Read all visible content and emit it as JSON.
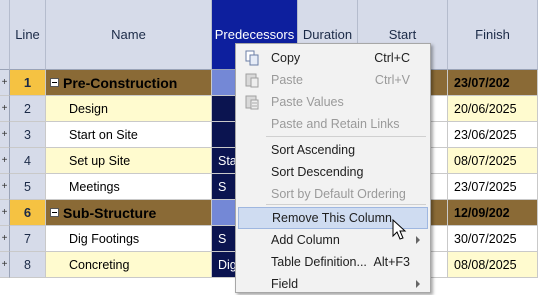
{
  "headers": {
    "line": "Line",
    "name": "Name",
    "predecessors": "Predecessors",
    "duration": "Duration",
    "start": "Start",
    "finish": "Finish"
  },
  "rows": [
    {
      "marker": "+",
      "line": "1",
      "name": "Pre-Construction",
      "pred": "",
      "finish": "23/07/202"
    },
    {
      "marker": "+",
      "line": "2",
      "name": "Design",
      "pred": "",
      "finish": "20/06/2025"
    },
    {
      "marker": "+",
      "line": "3",
      "name": "Start on Site",
      "pred": "",
      "finish": "23/06/2025"
    },
    {
      "marker": "+",
      "line": "4",
      "name": "Set up Site",
      "pred": "Sta",
      "finish": "08/07/2025"
    },
    {
      "marker": "+",
      "line": "5",
      "name": "Meetings",
      "pred": "S",
      "finish": "23/07/2025"
    },
    {
      "marker": "+",
      "line": "6",
      "name": "Sub-Structure",
      "pred": "",
      "finish": "12/09/202"
    },
    {
      "marker": "+",
      "line": "7",
      "name": "Dig Footings",
      "pred": "S",
      "finish": "30/07/2025"
    },
    {
      "marker": "+",
      "line": "8",
      "name": "Concreting",
      "pred": "Dig",
      "finish": "08/08/2025"
    }
  ],
  "menu": [
    {
      "label": "Copy",
      "shortcut": "Ctrl+C",
      "icon": "copy-icon",
      "disabled": false
    },
    {
      "label": "Paste",
      "shortcut": "Ctrl+V",
      "icon": "paste-icon",
      "disabled": true
    },
    {
      "label": "Paste Values",
      "shortcut": "",
      "icon": "paste-values-icon",
      "disabled": true
    },
    {
      "label": "Paste and Retain Links",
      "shortcut": "",
      "icon": "",
      "disabled": true
    },
    {
      "label": "Sort Ascending",
      "shortcut": "",
      "icon": "",
      "disabled": false
    },
    {
      "label": "Sort Descending",
      "shortcut": "",
      "icon": "",
      "disabled": false
    },
    {
      "label": "Sort by Default Ordering",
      "shortcut": "",
      "icon": "",
      "disabled": true
    },
    {
      "label": "Remove This Column",
      "shortcut": "",
      "icon": "",
      "disabled": false,
      "highlighted": true
    },
    {
      "label": "Add Column",
      "shortcut": "",
      "icon": "",
      "disabled": false,
      "submenu": true
    },
    {
      "label": "Table Definition...",
      "shortcut": "Alt+F3",
      "icon": "",
      "disabled": false
    },
    {
      "label": "Field",
      "shortcut": "",
      "icon": "",
      "disabled": false,
      "submenu": true
    }
  ],
  "colors": {
    "header_bg": "#d6dbe9",
    "selected_header": "#0d1f9e",
    "summary_bg": "#8a6a36",
    "summary_line": "#f5c242",
    "task_odd": "#fffbcf",
    "pred_col": "#0b1450",
    "menu_highlight": "#cfdcf1"
  }
}
